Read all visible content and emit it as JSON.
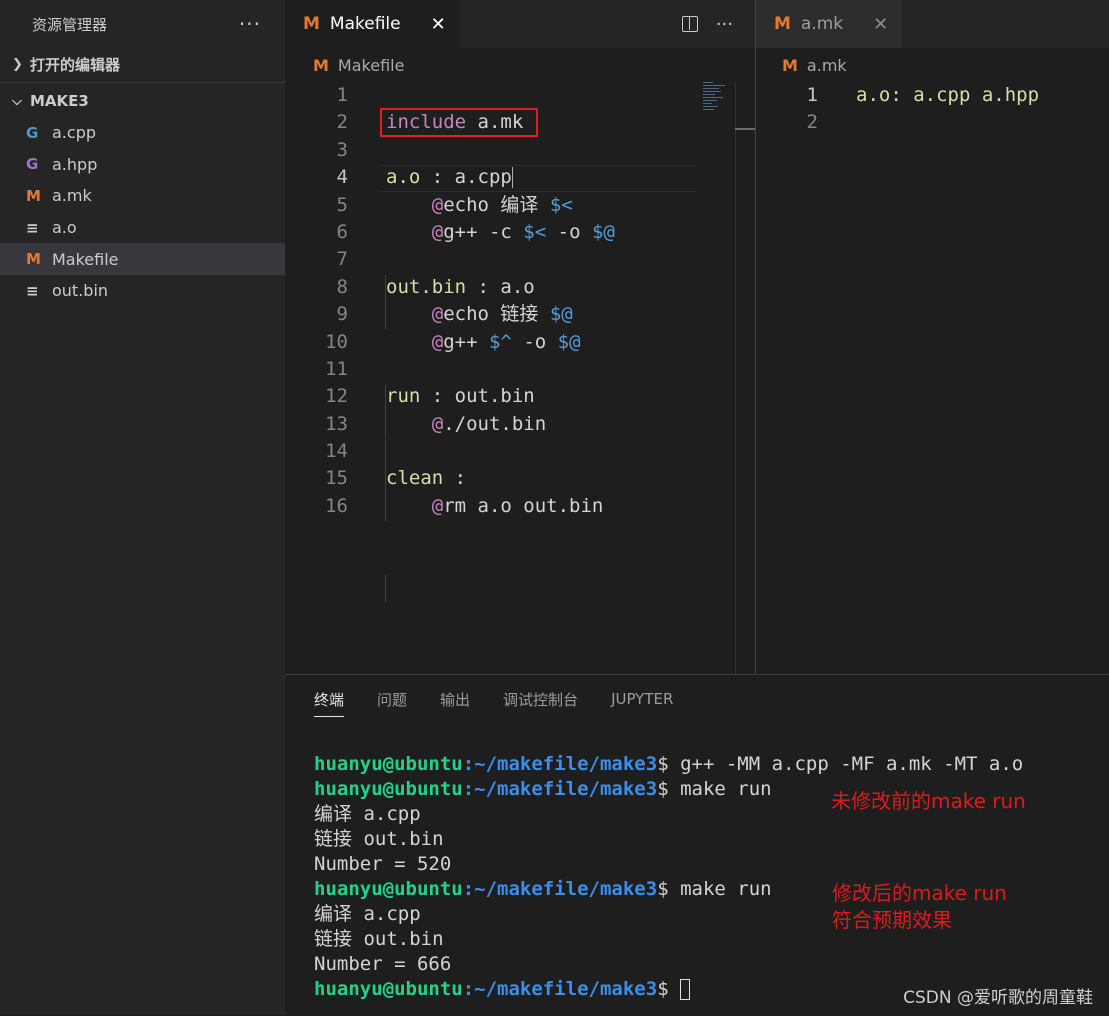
{
  "sidebar": {
    "title": "资源管理器",
    "more": "···",
    "open_editors": "打开的编辑器",
    "folder": "MAKE3",
    "files": [
      {
        "icon": "G",
        "name": "a.cpp",
        "icon_color": "#519aba"
      },
      {
        "icon": "G",
        "name": "a.hpp",
        "icon_color": "#a074c4"
      },
      {
        "icon": "M",
        "name": "a.mk",
        "icon_color": "#e37933"
      },
      {
        "icon": "≡",
        "name": "a.o",
        "icon_color": "#cccccc"
      },
      {
        "icon": "M",
        "name": "Makefile",
        "icon_color": "#e37933"
      },
      {
        "icon": "≡",
        "name": "out.bin",
        "icon_color": "#cccccc"
      }
    ]
  },
  "left_editor": {
    "tab_icon": "M",
    "tab_label": "Makefile",
    "close": "✕",
    "more": "···",
    "breadcrumb": "Makefile",
    "line_numbers": [
      "1",
      "2",
      "3",
      "4",
      "5",
      "6",
      "7",
      "8",
      "9",
      "10",
      "11",
      "12",
      "13",
      "14",
      "15",
      "16"
    ],
    "code": {
      "l2_kw": "include",
      "l2_rest": " a.mk",
      "l4_target": "a.o",
      "l4_rest": " : a.cpp",
      "l5_at": "@",
      "l5_cmd": "echo 编译 ",
      "l5_var": "$<",
      "l6_at": "@",
      "l6_cmd": "g++ -c ",
      "l6_var1": "$<",
      "l6_mid": " -o ",
      "l6_var2": "$@",
      "l8_target": "out.bin",
      "l8_rest": " : a.o",
      "l9_at": "@",
      "l9_cmd": "echo 链接 ",
      "l9_var": "$@",
      "l10_at": "@",
      "l10_cmd": "g++ ",
      "l10_var1": "$^",
      "l10_mid": " -o ",
      "l10_var2": "$@",
      "l12_target": "run",
      "l12_rest": " : out.bin",
      "l13_at": "@",
      "l13_cmd": "./out.bin",
      "l15_target": "clean",
      "l15_rest": " :",
      "l16_at": "@",
      "l16_cmd": "rm a.o out.bin"
    }
  },
  "right_editor": {
    "tab_icon": "M",
    "tab_label": "a.mk",
    "close": "✕",
    "breadcrumb": "a.mk",
    "line_numbers": [
      "1",
      "2"
    ],
    "l1_target": "a.o",
    "l1_rest": ": a.cpp a.hpp"
  },
  "panel": {
    "tabs": [
      "终端",
      "问题",
      "输出",
      "调试控制台",
      "JUPYTER"
    ],
    "active_tab": "终端",
    "prompt_user": "huanyu@ubuntu",
    "prompt_path": ":~/makefile/make3",
    "prompt_end": "$ ",
    "lines": {
      "cmd1": "g++ -MM a.cpp -MF a.mk -MT a.o",
      "cmd2": "make run",
      "out1": "编译 a.cpp",
      "out2": "链接 out.bin",
      "out3": "Number = 520",
      "cmd3": "make run",
      "out4": "编译 a.cpp",
      "out5": "链接 out.bin",
      "out6": "Number = 666"
    }
  },
  "annotations": {
    "note1": "未修改前的make run",
    "note2a": "修改后的make run",
    "note2b": "符合预期效果",
    "highlight_color": "#e51c23"
  },
  "watermark": "CSDN @爱听歌的周童鞋"
}
